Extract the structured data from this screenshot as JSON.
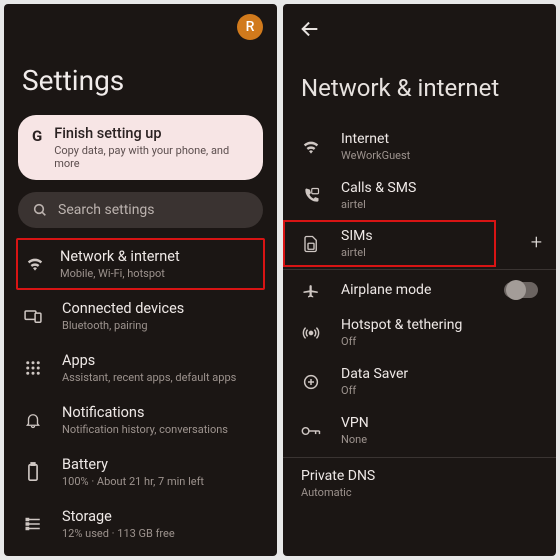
{
  "left": {
    "avatar_letter": "R",
    "title": "Settings",
    "card": {
      "g": "G",
      "title": "Finish setting up",
      "subtitle": "Copy data, pay with your phone, and more"
    },
    "search_placeholder": "Search settings",
    "items": [
      {
        "title": "Network & internet",
        "sub": "Mobile, Wi-Fi, hotspot",
        "highlight": true
      },
      {
        "title": "Connected devices",
        "sub": "Bluetooth, pairing"
      },
      {
        "title": "Apps",
        "sub": "Assistant, recent apps, default apps"
      },
      {
        "title": "Notifications",
        "sub": "Notification history, conversations"
      },
      {
        "title": "Battery",
        "sub": "100% · About 21 hr, 7 min left"
      },
      {
        "title": "Storage",
        "sub": "12% used · 113 GB free"
      }
    ]
  },
  "right": {
    "title": "Network & internet",
    "rows": [
      {
        "title": "Internet",
        "sub": "WeWorkGuest"
      },
      {
        "title": "Calls & SMS",
        "sub": "airtel"
      },
      {
        "title": "SIMs",
        "sub": "airtel",
        "highlight": true,
        "plus": true
      },
      {
        "title": "Airplane mode",
        "toggle": true
      },
      {
        "title": "Hotspot & tethering",
        "sub": "Off"
      },
      {
        "title": "Data Saver",
        "sub": "Off"
      },
      {
        "title": "VPN",
        "sub": "None"
      }
    ],
    "private_dns": {
      "title": "Private DNS",
      "sub": "Automatic"
    }
  }
}
